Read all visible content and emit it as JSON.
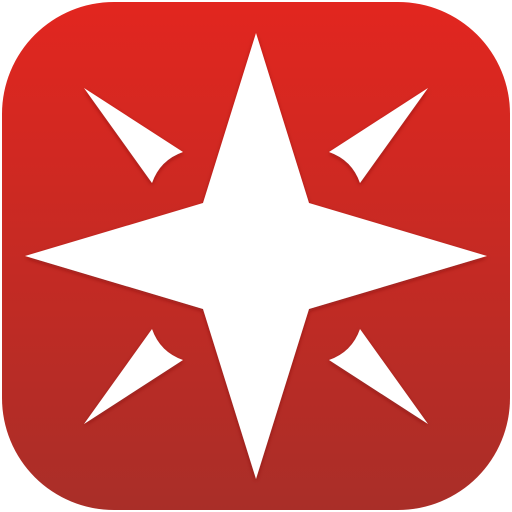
{
  "app_icon": {
    "name": "compass-star-app-icon",
    "colors": {
      "background_top": "#E2261F",
      "background_bottom": "#A92E28",
      "mark": "#FFFFFF",
      "mark_shadow": "#7A1410"
    }
  }
}
